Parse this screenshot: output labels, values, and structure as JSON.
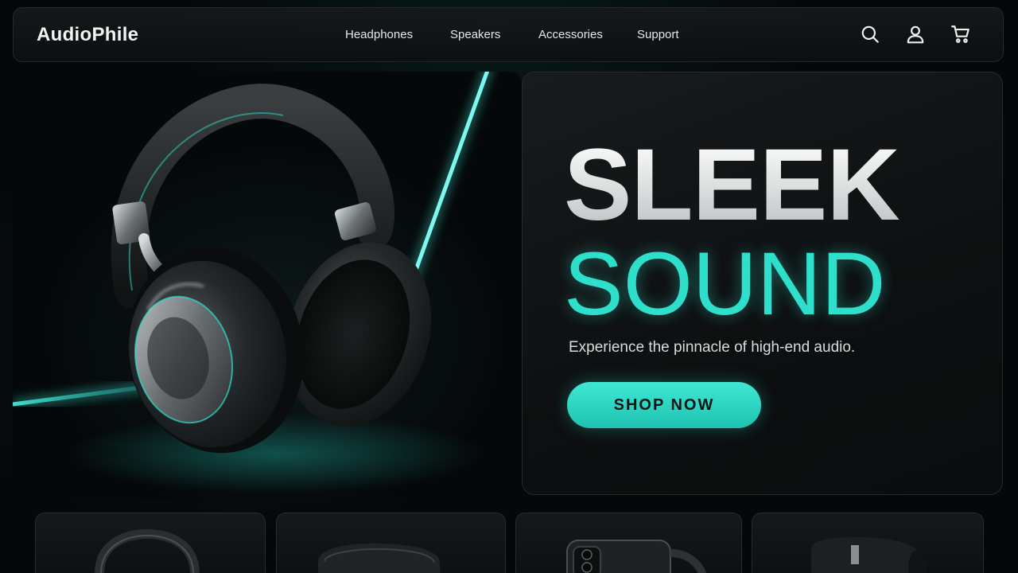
{
  "brand": {
    "logo": "AudioPhile"
  },
  "nav": {
    "links": [
      "Headphones",
      "Speakers",
      "Accessories",
      "Support"
    ],
    "icons": [
      "search-icon",
      "user-icon",
      "cart-icon"
    ]
  },
  "hero": {
    "headline_line1": "SLEEK",
    "headline_line2": "SOUND",
    "subtitle": "Experience the pinnacle of high-end audio.",
    "cta_label": "SHOP NOW",
    "image_subject": "headphones"
  },
  "products": [
    {
      "icon": "headphones-icon"
    },
    {
      "icon": "earbuds-case-icon"
    },
    {
      "icon": "phone-icon"
    },
    {
      "icon": "speaker-icon"
    }
  ],
  "colors": {
    "background": "#050708",
    "accent": "#2ee0cc",
    "panel": "#15191b",
    "text": "#e8ecec"
  }
}
